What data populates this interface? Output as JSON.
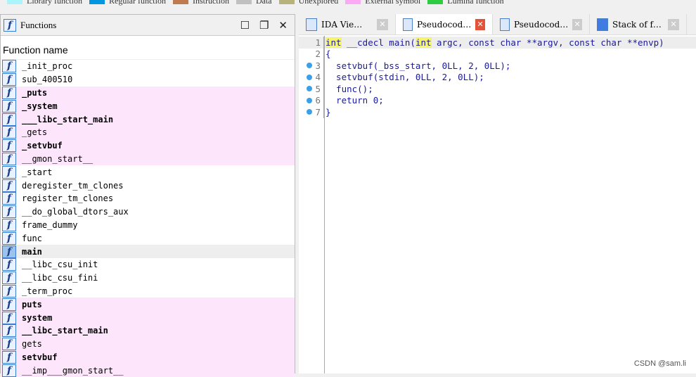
{
  "legend": [
    {
      "label": "Library function",
      "color": "#aaf5fb"
    },
    {
      "label": "Regular function",
      "color": "#0096e0"
    },
    {
      "label": "Instruction",
      "color": "#c07a50"
    },
    {
      "label": "Data",
      "color": "#c0c0c0"
    },
    {
      "label": "Unexplored",
      "color": "#b8b37a"
    },
    {
      "label": "External symbol",
      "color": "#fcaaf5"
    },
    {
      "label": "Lumina function",
      "color": "#2ecc40"
    }
  ],
  "functions_panel": {
    "title": "Functions",
    "column_header": "Function name",
    "rows": [
      {
        "name": "_init_proc",
        "type": "regular",
        "bold": false
      },
      {
        "name": "sub_400510",
        "type": "regular",
        "bold": false
      },
      {
        "name": "_puts",
        "type": "external",
        "bold": true
      },
      {
        "name": "_system",
        "type": "external",
        "bold": true
      },
      {
        "name": "___libc_start_main",
        "type": "external",
        "bold": true
      },
      {
        "name": "_gets",
        "type": "external",
        "bold": false
      },
      {
        "name": "_setvbuf",
        "type": "external",
        "bold": true
      },
      {
        "name": "__gmon_start__",
        "type": "external",
        "bold": false
      },
      {
        "name": "_start",
        "type": "regular",
        "bold": false
      },
      {
        "name": "deregister_tm_clones",
        "type": "regular",
        "bold": false
      },
      {
        "name": "register_tm_clones",
        "type": "regular",
        "bold": false
      },
      {
        "name": "__do_global_dtors_aux",
        "type": "regular",
        "bold": false
      },
      {
        "name": "frame_dummy",
        "type": "regular",
        "bold": false
      },
      {
        "name": "func",
        "type": "regular",
        "bold": false
      },
      {
        "name": "main",
        "type": "regular",
        "bold": true,
        "selected": true
      },
      {
        "name": "__libc_csu_init",
        "type": "regular",
        "bold": false
      },
      {
        "name": "__libc_csu_fini",
        "type": "regular",
        "bold": false
      },
      {
        "name": "_term_proc",
        "type": "regular",
        "bold": false
      },
      {
        "name": "puts",
        "type": "external",
        "bold": true
      },
      {
        "name": "system",
        "type": "external",
        "bold": true
      },
      {
        "name": "__libc_start_main",
        "type": "external",
        "bold": true
      },
      {
        "name": "gets",
        "type": "external",
        "bold": false
      },
      {
        "name": "setvbuf",
        "type": "external",
        "bold": true
      },
      {
        "name": "__imp___gmon_start__",
        "type": "external",
        "bold": false
      }
    ]
  },
  "tabs": [
    {
      "label": "IDA Vie…",
      "icon": "view-icon",
      "active": false
    },
    {
      "label": "Pseudocod…",
      "icon": "pseudocode-icon",
      "active": true
    },
    {
      "label": "Pseudocod…",
      "icon": "pseudocode-icon",
      "active": false
    },
    {
      "label": "Stack of f…",
      "icon": "stack-icon",
      "active": false
    }
  ],
  "code": [
    {
      "n": "1",
      "bp": false,
      "text": "int __cdecl main(int argc, const char **argv, const char **envp)"
    },
    {
      "n": "2",
      "bp": false,
      "text": "{"
    },
    {
      "n": "3",
      "bp": true,
      "text": "  setvbuf(_bss_start, 0LL, 2, 0LL);"
    },
    {
      "n": "4",
      "bp": true,
      "text": "  setvbuf(stdin, 0LL, 2, 0LL);"
    },
    {
      "n": "5",
      "bp": true,
      "text": "  func();"
    },
    {
      "n": "6",
      "bp": true,
      "text": "  return 0;"
    },
    {
      "n": "7",
      "bp": true,
      "text": "}"
    }
  ],
  "watermark": "CSDN @sam.li"
}
